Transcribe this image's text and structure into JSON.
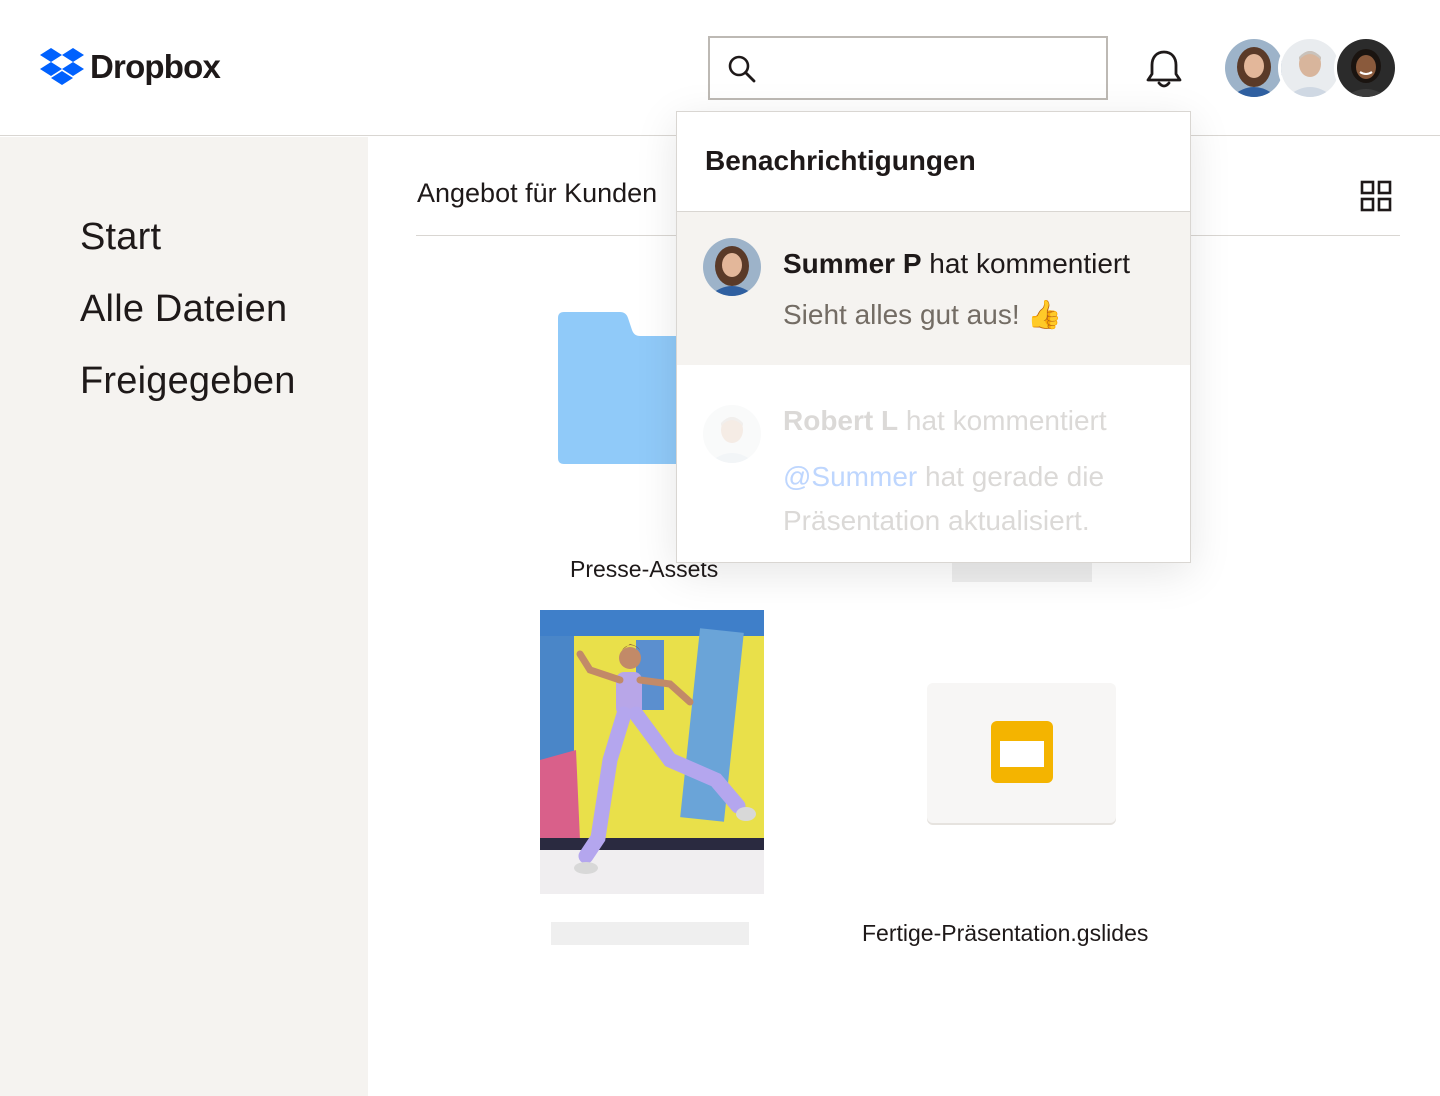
{
  "app": {
    "name": "Dropbox"
  },
  "header": {
    "search": {
      "placeholder": ""
    },
    "icons": [
      "search-icon",
      "bell-icon"
    ],
    "avatars": [
      "avatar-summer",
      "avatar-robert",
      "avatar-third-user"
    ]
  },
  "sidebar": {
    "items": [
      {
        "label": "Start"
      },
      {
        "label": "Alle Dateien"
      },
      {
        "label": "Freigegeben"
      }
    ]
  },
  "main": {
    "title": "Angebot für Kunden",
    "view_toggle_icon": "grid-view-icon",
    "files": [
      {
        "label": "Presse-Assets",
        "type": "folder",
        "icon": "folder-icon"
      },
      {
        "label": "",
        "type": "placeholder"
      },
      {
        "label": "",
        "type": "image"
      },
      {
        "label": "Fertige-Präsentation.gslides",
        "type": "gslides",
        "icon": "slides-icon"
      }
    ]
  },
  "notifications": {
    "title": "Benachrichtigungen",
    "items": [
      {
        "name": "Summer P",
        "action": " hat kommentiert",
        "message": "Sieht alles gut aus! 👍"
      },
      {
        "name": "Robert L",
        "action": " hat kommentiert",
        "mention": "@Summer",
        "message": " hat gerade die Präsentation aktualisiert."
      }
    ]
  },
  "colors": {
    "brand": "#0061fe",
    "folder": "#90caf9",
    "slides": "#f4b400",
    "sidebar_bg": "#f5f3f0"
  }
}
